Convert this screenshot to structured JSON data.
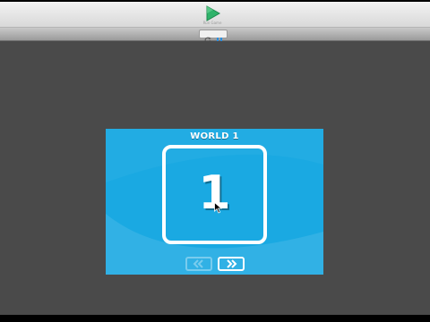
{
  "toolbar": {
    "play_label": "Run Game",
    "play_icon": "play-icon"
  },
  "controls": {
    "reload_icon": "reload-icon",
    "pause_icon": "pause-icon"
  },
  "game": {
    "world_title": "WORLD 1",
    "level_number": "1",
    "prev_icon": "double-chevron-left-icon",
    "next_icon": "double-chevron-right-icon"
  },
  "colors": {
    "stage_bg": "#4a4a4a",
    "panel_blue": "#1aa9e2",
    "play_green": "#2fb36a",
    "pause_blue": "#2a8fe0"
  }
}
